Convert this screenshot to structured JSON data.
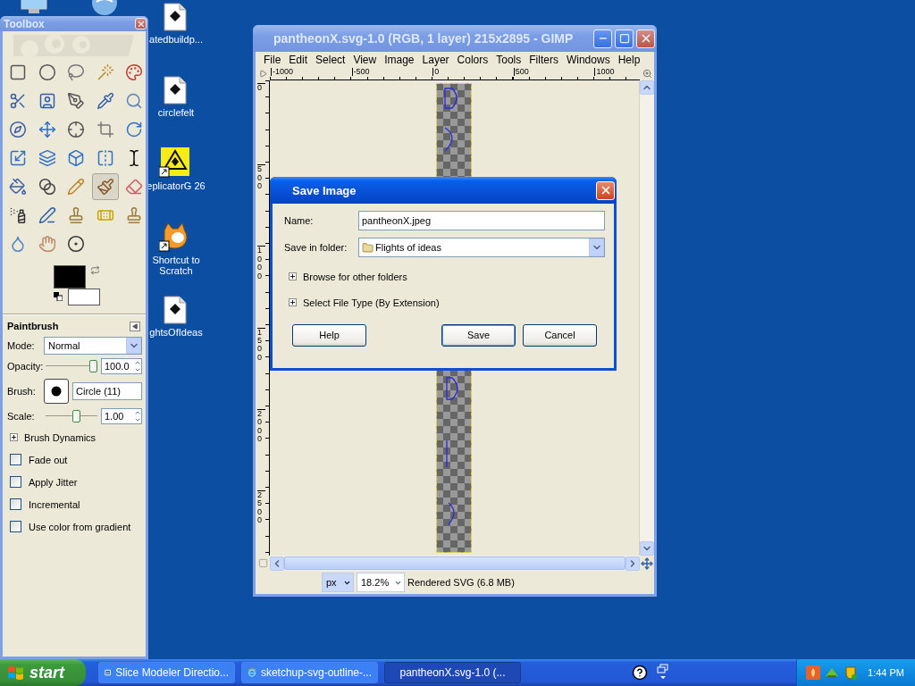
{
  "desktop_icons": [
    {
      "label": "atedbuildp..."
    },
    {
      "label": "circlefelt"
    },
    {
      "label": "eplicatorG 26"
    },
    {
      "label": "Shortcut to Scratch"
    },
    {
      "label": "ghtsOfIdeas"
    }
  ],
  "toolbox": {
    "title": "Toolbox",
    "tools": [
      {
        "selected": false
      },
      {
        "selected": false
      },
      {
        "selected": false
      },
      {
        "selected": false
      },
      {
        "selected": false
      },
      {
        "selected": false
      },
      {
        "selected": false
      },
      {
        "selected": false
      },
      {
        "selected": false
      },
      {
        "selected": false
      },
      {
        "selected": false
      },
      {
        "selected": false
      },
      {
        "selected": false
      },
      {
        "selected": false
      },
      {
        "selected": false
      },
      {
        "selected": false
      },
      {
        "selected": false
      },
      {
        "selected": false
      },
      {
        "selected": false
      },
      {
        "selected": false
      },
      {
        "selected": false
      },
      {
        "selected": false
      },
      {
        "selected": false
      },
      {
        "selected": true
      },
      {
        "selected": false
      },
      {
        "selected": false
      },
      {
        "selected": false
      },
      {
        "selected": false
      },
      {
        "selected": false
      },
      {
        "selected": false
      },
      {
        "selected": false
      },
      {
        "selected": false
      },
      {
        "selected": false
      }
    ],
    "swatches": [
      {
        "color": "#000000"
      },
      {
        "color": "#ffffff"
      }
    ]
  },
  "tool_options": {
    "title": "Paintbrush",
    "mode": {
      "label": "Mode:",
      "value": "Normal"
    },
    "opacity": {
      "label": "Opacity:",
      "level": 1,
      "value": "100.0"
    },
    "brush": {
      "label": "Brush:",
      "value": "Circle (11)"
    },
    "scale": {
      "label": "Scale:",
      "level": 0.62,
      "value": "1.00"
    },
    "expander": {
      "label": "Brush Dynamics",
      "expanded": false
    },
    "checkboxes": [
      {
        "label": "Fade out",
        "checked": false
      },
      {
        "label": "Apply Jitter",
        "checked": false
      },
      {
        "label": "Incremental",
        "checked": false
      },
      {
        "label": "Use color from gradient",
        "checked": false
      }
    ]
  },
  "gimp_window": {
    "title": "pantheonX.svg-1.0 (RGB, 1 layer) 215x2895 - GIMP",
    "menu": [
      "File",
      "Edit",
      "Select",
      "View",
      "Image",
      "Layer",
      "Colors",
      "Tools",
      "Filters",
      "Windows",
      "Help"
    ],
    "hruler": [
      "-1000",
      "-500",
      "0",
      "500",
      "1000"
    ],
    "vruler": [
      "0",
      "500",
      "1000",
      "1500",
      "2000",
      "2500"
    ],
    "status": {
      "unit": "px",
      "zoom": "18.2%",
      "message": "Rendered SVG (6.8 MB)"
    }
  },
  "dialog": {
    "title": "Save Image",
    "name": {
      "label": "Name:",
      "value": "pantheonX.jpeg"
    },
    "folder": {
      "label": "Save in folder:",
      "value": "Flights of ideas"
    },
    "expanders": [
      {
        "label": "Browse for other folders",
        "expanded": false
      },
      {
        "label": "Select File Type (By Extension)",
        "expanded": false
      }
    ],
    "buttons": [
      "Help",
      "Save",
      "Cancel"
    ]
  },
  "taskbar": {
    "start": "start",
    "tasks": [
      {
        "label": "Slice Modeler Directio...",
        "selected": false
      },
      {
        "label": "sketchup-svg-outline-...",
        "selected": false
      },
      {
        "label": "pantheonX.svg-1.0 (...",
        "selected": true
      }
    ],
    "clock": "1:44 PM"
  }
}
